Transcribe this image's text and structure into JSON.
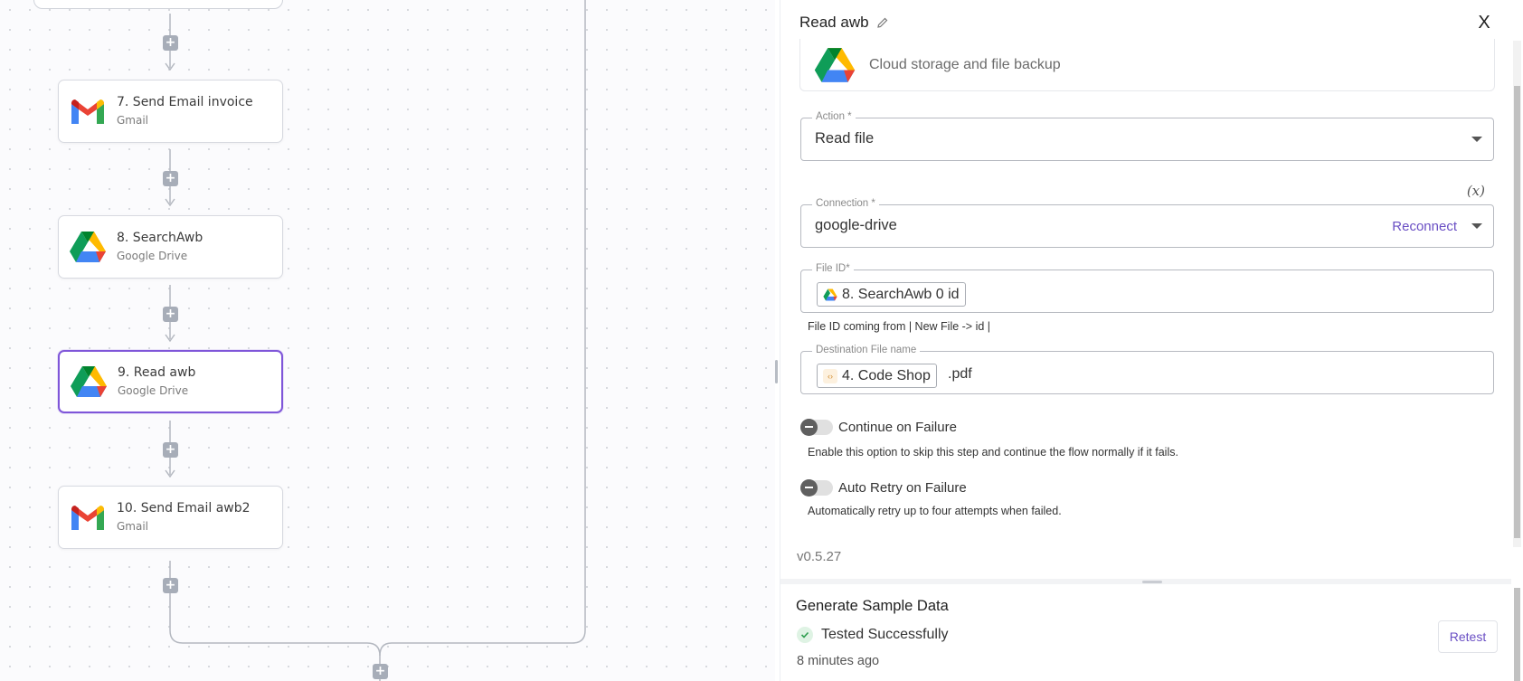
{
  "canvas": {
    "steps": [
      {
        "title": "7. Send Email invoice",
        "subtitle": "Gmail",
        "logo": "gmail-logo"
      },
      {
        "title": "8. SearchAwb",
        "subtitle": "Google Drive",
        "logo": "google-drive-logo"
      },
      {
        "title": "9. Read awb",
        "subtitle": "Google Drive",
        "logo": "google-drive-logo",
        "selected": true
      },
      {
        "title": "10. Send Email awb2",
        "subtitle": "Gmail",
        "logo": "gmail-logo"
      }
    ],
    "add_step_symbol": "+"
  },
  "panel": {
    "title": "Read awb",
    "close_label": "X",
    "piece": {
      "description": "Cloud storage and file backup"
    },
    "action": {
      "label": "Action *",
      "value": "Read file"
    },
    "variable_toggle": "(x)",
    "connection": {
      "label": "Connection *",
      "value": "google-drive",
      "reconnect_label": "Reconnect"
    },
    "file_id": {
      "label": "File ID*",
      "chip": "8. SearchAwb 0 id",
      "helper": "File ID coming from | New File -> id |"
    },
    "destination": {
      "label": "Destination File name",
      "chip": "4. Code Shop",
      "suffix": ".pdf"
    },
    "continue_on_failure": {
      "label": "Continue on Failure",
      "helper": "Enable this option to skip this step and continue the flow normally if it fails."
    },
    "auto_retry": {
      "label": "Auto Retry on Failure",
      "helper": "Automatically retry up to four attempts when failed."
    },
    "version": "v0.5.27"
  },
  "sample_data": {
    "title": "Generate Sample Data",
    "status": "Tested Successfully",
    "time": "8 minutes ago",
    "retest_label": "Retest"
  },
  "colors": {
    "accent": "#7f56d9",
    "link": "#6a4fc4",
    "success": "#2e9e4f"
  }
}
